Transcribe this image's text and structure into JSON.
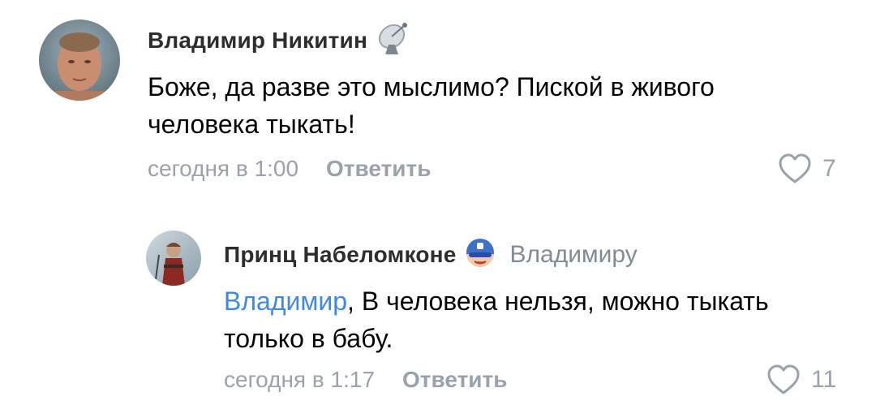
{
  "comments": [
    {
      "author": "Владимир Никитин",
      "badge_icon": "satellite-dish-icon",
      "text": "Боже, да разве это мыслимо? Пиской в живого человека тыкать!",
      "time": "сегодня в 1:00",
      "reply_label": "Ответить",
      "likes": "7"
    },
    {
      "author": "Принц Набеломконе",
      "badge_icon": "captain-mask-icon",
      "reply_to": "Владимиру",
      "mention": "Владимир",
      "text_after_mention": ", В человека нельзя, можно тыкать только в бабу.",
      "time": "сегодня в 1:17",
      "reply_label": "Ответить",
      "likes": "11"
    }
  ],
  "colors": {
    "secondary_text": "#99a2ad",
    "mention": "#3f8ae0",
    "author": "#2c2d2e"
  }
}
